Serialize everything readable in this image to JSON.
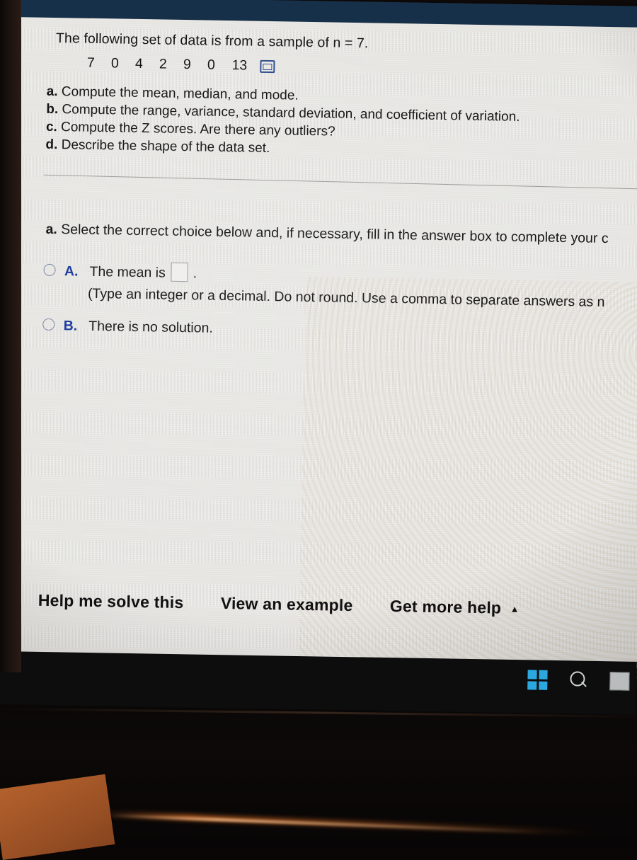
{
  "window": {
    "header_color": "#173049",
    "page_bg": "#e8e7e3"
  },
  "problem": {
    "prompt": "The following set of data is from a sample of n = 7.",
    "data_values": [
      "7",
      "0",
      "4",
      "2",
      "9",
      "0",
      "13"
    ],
    "data_popup_icon": "popup-window-icon",
    "parts": [
      {
        "letter": "a.",
        "text": "Compute the mean, median, and mode."
      },
      {
        "letter": "b.",
        "text": "Compute the range, variance, standard deviation, and coefficient of variation."
      },
      {
        "letter": "c.",
        "text": "Compute the Z scores. Are there any outliers?"
      },
      {
        "letter": "d.",
        "text": "Describe the shape of the data set."
      }
    ]
  },
  "answer_section": {
    "instruction_letter": "a.",
    "instruction_text": "Select the correct choice below and, if necessary, fill in the answer box to complete your c",
    "choices": [
      {
        "letter": "A.",
        "text_before_box": "The mean is",
        "text_after_box": ".",
        "input_value": "",
        "input_placeholder": "",
        "selected": false
      },
      {
        "letter": "B.",
        "text_before_box": "There is no solution.",
        "text_after_box": "",
        "input_value": "",
        "input_placeholder": "",
        "selected": false
      }
    ],
    "hint": "(Type an integer or a decimal. Do not round. Use a comma to separate answers as n"
  },
  "actions": [
    {
      "label": "Help me solve this",
      "caret": ""
    },
    {
      "label": "View an example",
      "caret": ""
    },
    {
      "label": "Get more help",
      "caret": "▲"
    }
  ],
  "taskbar": {
    "icons": [
      "windows-start-icon",
      "search-icon",
      "app-icon"
    ],
    "accent_color": "#2ca8e0",
    "bg_color": "#0d0d0e"
  }
}
